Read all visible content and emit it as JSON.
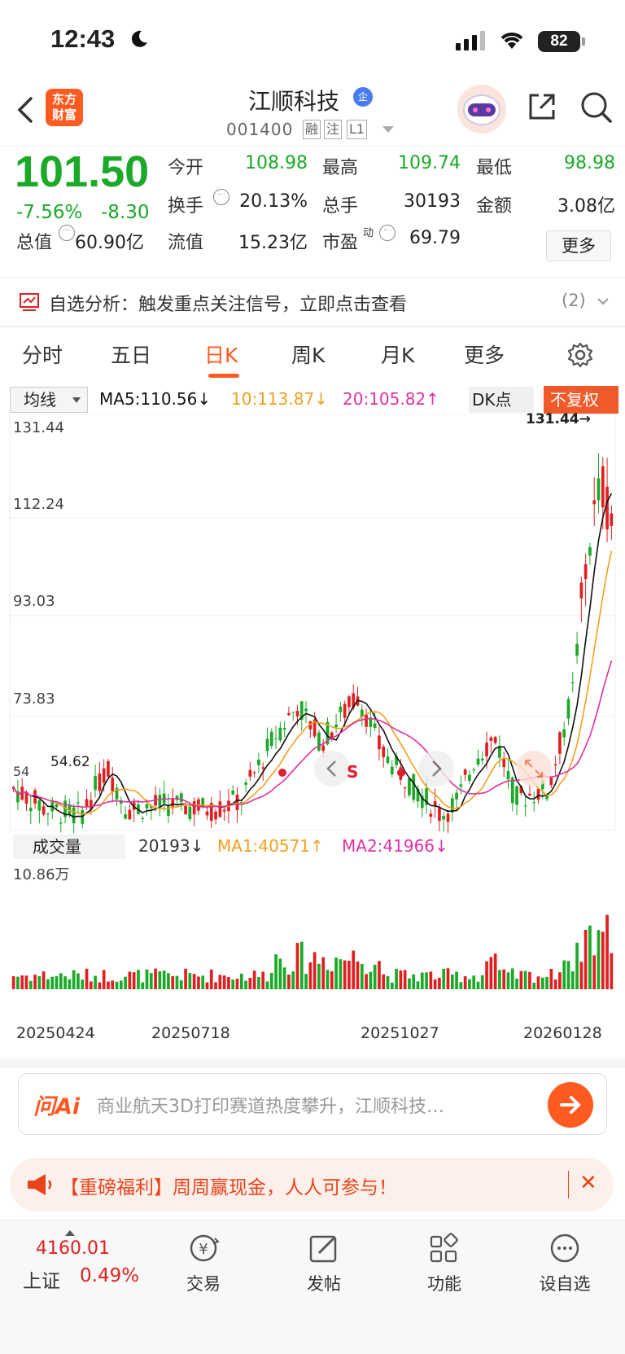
{
  "status": {
    "time": "12:43",
    "battery": "82"
  },
  "nav": {
    "stock_name": "江顺科技",
    "ent_badge": "企",
    "stock_code": "001400",
    "tags": [
      "融",
      "注",
      "L1"
    ],
    "logo_line1": "东方",
    "logo_line2": "财富"
  },
  "quote": {
    "price": "101.50",
    "change_pct": "-7.56%",
    "change_amt": "-8.30",
    "open_label": "今开",
    "open": "108.98",
    "high_label": "最高",
    "high": "109.74",
    "low_label": "最低",
    "low": "98.98",
    "turnover_label": "换手",
    "turnover": "20.13%",
    "volume_label": "总手",
    "volume": "30193",
    "amount_label": "金额",
    "amount": "3.08亿",
    "mktcap_label": "总值",
    "mktcap": "60.90亿",
    "float_label": "流值",
    "float": "15.23亿",
    "pe_label": "市盈",
    "pe_sup": "动",
    "pe": "69.79",
    "more": "更多"
  },
  "analysis": {
    "text": "自选分析：触发重点关注信号，立即点击查看",
    "count": "(2)"
  },
  "tabs": [
    "分时",
    "五日",
    "日K",
    "周K",
    "月K",
    "更多"
  ],
  "ma": {
    "select": "均线",
    "ma5": "MA5:110.56↓",
    "ma10": "10:113.87↓",
    "ma20": "20:105.82↑",
    "dk": "DK点",
    "noadj": "不复权"
  },
  "chart_data": {
    "type": "candlestick",
    "y_ticks": [
      "131.44",
      "112.24",
      "93.03",
      "73.83"
    ],
    "max_label": "131.44→",
    "min_label": "54.62",
    "low_tick": "54",
    "x_labels": [
      "20250424",
      "20250718",
      "20251027",
      "20260128"
    ],
    "colors": {
      "up": "#e02020",
      "down": "#1aa928",
      "ma5": "#111111",
      "ma10": "#f0a020",
      "ma20": "#e030a0"
    }
  },
  "volume": {
    "label": "成交量",
    "vol": "20193↓",
    "ma1": "MA1:40571↑",
    "ma2": "MA2:41966↓",
    "max": "10.86万"
  },
  "ai": {
    "logo": "问Ai",
    "text": "商业航天3D打印赛道热度攀升，江顺科技…"
  },
  "promo": {
    "text": "【重磅福利】周周赢现金，人人可参与！"
  },
  "bottom": {
    "index_value": "4160.01",
    "index_name": "上证",
    "index_pct": "0.49%",
    "items": [
      "交易",
      "发帖",
      "功能",
      "设自选"
    ]
  }
}
